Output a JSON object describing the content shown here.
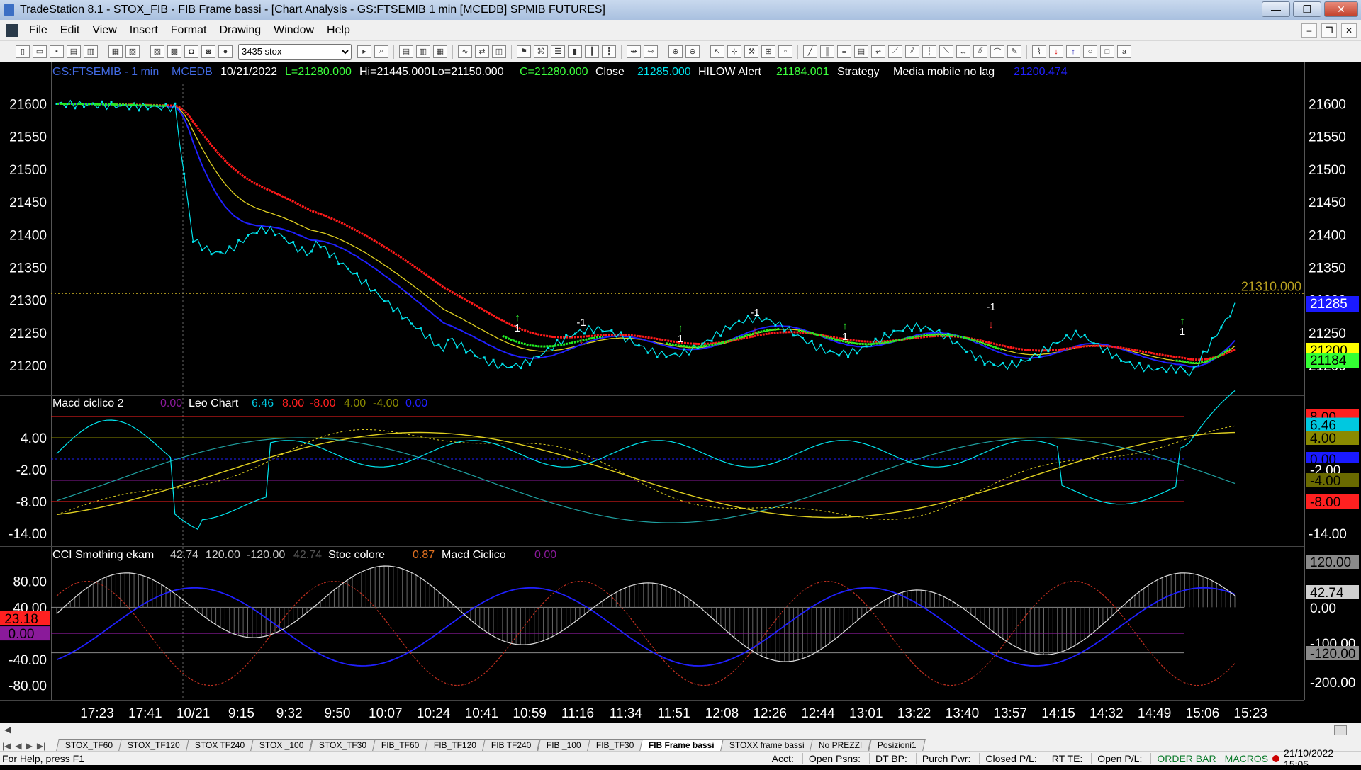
{
  "window": {
    "title": "TradeStation 8.1 - STOX_FIB - FIB Frame bassi - [Chart Analysis - GS:FTSEMIB  1 min  [MCEDB] SPMIB FUTURES]",
    "min_glyph": "—",
    "max_glyph": "❐",
    "close_glyph": "✕"
  },
  "menu": [
    "File",
    "Edit",
    "View",
    "Insert",
    "Format",
    "Drawing",
    "Window",
    "Help"
  ],
  "toolbar": {
    "symbol_value": "3435 stox"
  },
  "chart": {
    "header": {
      "symbol": "GS:FTSEMIB - 1 min",
      "feed": "MCEDB",
      "date": "10/21/2022",
      "last": "L=21280.000",
      "hi": "Hi=21445.000",
      "lo": "Lo=21150.000",
      "close_eq": "C=21280.000",
      "close_label": "Close",
      "close_val": "21285.000",
      "hilow_label": "HILOW Alert",
      "hilow_val": "21184.001",
      "strategy_label": "Strategy",
      "mm_label": "Media mobile no lag",
      "mm_val": "21200.474"
    },
    "hline_label": "21310.000",
    "price_axis": [
      "21600",
      "21550",
      "21500",
      "21450",
      "21400",
      "21350",
      "21300",
      "21250",
      "21200"
    ],
    "price_badges": [
      {
        "text": "21285",
        "bg": "#1a1aff",
        "fg": "#ffffff"
      },
      {
        "text": "21200",
        "bg": "#ffff00",
        "fg": "#000000"
      },
      {
        "text": "21184",
        "bg": "#33ff33",
        "fg": "#000000"
      }
    ],
    "markers": [
      "1",
      "-1",
      "1",
      "-1",
      "1",
      "-1",
      "1"
    ],
    "macd": {
      "title": "Macd ciclico 2",
      "v1": "0.00",
      "leo": "Leo Chart",
      "v2": "6.46",
      "v3": "8.00",
      "v4": "-8.00",
      "v5": "4.00",
      "v6": "-4.00",
      "v7": "0.00",
      "axis": [
        "4.00",
        "-2.00",
        "-8.00",
        "-14.00"
      ],
      "badges": [
        {
          "text": "8.00",
          "bg": "#ff2020",
          "fg": "#000000"
        },
        {
          "text": "6.46",
          "bg": "#00c8e0",
          "fg": "#000000"
        },
        {
          "text": "4.00",
          "bg": "#8a8a00",
          "fg": "#000000"
        },
        {
          "text": "0.00",
          "bg": "#1a1aff",
          "fg": "#000000"
        },
        {
          "text": "-2.00",
          "bg": "#000000",
          "fg": "#ffffff"
        },
        {
          "text": "-4.00",
          "bg": "#6a6a00",
          "fg": "#000000"
        },
        {
          "text": "-8.00",
          "bg": "#ff2020",
          "fg": "#000000"
        }
      ]
    },
    "cci": {
      "title": "CCI Smothing ekam",
      "v1": "42.74",
      "v2": "120.00",
      "v3": "-120.00",
      "v4": "42.74",
      "stoc": "Stoc colore",
      "v5": "0.87",
      "macdc": "Macd Ciclico",
      "v6": "0.00",
      "axis": [
        "80.00",
        "40.00",
        "-40.00",
        "-80.00"
      ],
      "badges_left": [
        {
          "text": "23.18",
          "bg": "#ff2020",
          "fg": "#000000"
        },
        {
          "text": "0.00",
          "bg": "#8a1a9a",
          "fg": "#000000"
        }
      ],
      "badges_right": [
        {
          "text": "120.00",
          "bg": "#8a8a8a",
          "fg": "#000000"
        },
        {
          "text": "42.74",
          "bg": "#d0d0d0",
          "fg": "#000000"
        },
        {
          "text": "0.00",
          "bg": "#000000",
          "fg": "#ffffff"
        },
        {
          "text": "-100.00",
          "bg": "#000000",
          "fg": "#ffffff"
        },
        {
          "text": "-120.00",
          "bg": "#8a8a8a",
          "fg": "#000000"
        },
        {
          "text": "-200.00",
          "bg": "#000000",
          "fg": "#ffffff"
        }
      ]
    },
    "time_axis": [
      "17:23",
      "17:41",
      "10/21",
      "9:15",
      "9:32",
      "9:50",
      "10:07",
      "10:24",
      "10:41",
      "10:59",
      "11:16",
      "11:34",
      "11:51",
      "12:08",
      "12:26",
      "12:44",
      "13:01",
      "13:22",
      "13:40",
      "13:57",
      "14:15",
      "14:32",
      "14:49",
      "15:06",
      "15:23"
    ]
  },
  "tabs": [
    "STOX_TF60",
    "STOX_TF120",
    "STOX TF240",
    "STOX _100",
    "STOX_TF30",
    "FIB_TF60",
    "FIB_TF120",
    "FIB TF240",
    "FIB _100",
    "FIB_TF30",
    "FIB Frame bassi",
    "STOXX frame bassi",
    "No PREZZI",
    "Posizioni1"
  ],
  "active_tab": "FIB Frame bassi",
  "status": {
    "help": "For Help, press F1",
    "acct": "Acct:",
    "open_psns": "Open Psns:",
    "dt_bp": "DT BP:",
    "purch": "Purch Pwr:",
    "closed_pl": "Closed P/L:",
    "rt_te": "RT TE:",
    "open_pl": "Open P/L:",
    "order_bar": "ORDER BAR",
    "macros": "MACROS",
    "datetime": "21/10/2022 15:05"
  },
  "colors": {
    "price": "#00e5ee",
    "red_ma": "#ff1a1a",
    "blue_ma": "#2020ff",
    "yellow_ma": "#e0d020",
    "green": "#22ee22"
  }
}
